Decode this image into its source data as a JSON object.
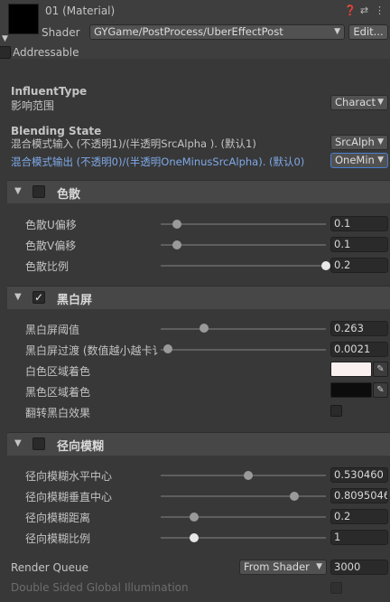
{
  "header": {
    "material_title": "01 (Material)",
    "shader_label": "Shader",
    "shader_value": "GYGame/PostProcess/UberEffectPost",
    "edit_label": "Edit...",
    "icons": [
      "help-icon",
      "preset-icon",
      "settings-icon"
    ],
    "addressable_label": "Addressable"
  },
  "influent": {
    "title": "InfluentType",
    "subtitle": "影响范围",
    "value": "Charact"
  },
  "blending": {
    "title": "Blending State",
    "src_label": "混合模式输入 (不透明1)/(半透明SrcAlpha ). (默认1)",
    "src_value": "SrcAlph",
    "dst_label": "混合模式输出 (不透明0)/(半透明OneMinusSrcAlpha). (默认0)",
    "dst_value": "OneMin"
  },
  "dispersion": {
    "title": "色散",
    "checked": false,
    "rows": [
      {
        "label": "色散U偏移",
        "value": "0.1",
        "pos": 0.1
      },
      {
        "label": "色散V偏移",
        "value": "0.1",
        "pos": 0.1
      },
      {
        "label": "色散比例",
        "value": "0.2",
        "pos": 1.0
      }
    ]
  },
  "bw": {
    "title": "黑白屏",
    "checked": true,
    "threshold_label": "黑白屏阈值",
    "threshold_value": "0.263",
    "threshold_pos": 0.263,
    "transition_label": "黑白屏过渡 (数值越小越卡讠",
    "transition_value": "0.0021",
    "transition_pos": 0.0021,
    "white_label": "白色区域着色",
    "white_color": "#fbf0f0",
    "black_label": "黑色区域着色",
    "black_color": "#0c0c0c",
    "invert_label": "翻转黑白效果"
  },
  "radial": {
    "title": "径向模糊",
    "checked": false,
    "rows": [
      {
        "label": "径向模糊水平中心",
        "value": "0.530460",
        "pos": 0.53046
      },
      {
        "label": "径向模糊垂直中心",
        "value": "0.8095046",
        "pos": 0.8095
      },
      {
        "label": "径向模糊距离",
        "value": "0.2",
        "pos": 0.2
      },
      {
        "label": "径向模糊比例",
        "value": "1",
        "pos": 0.2
      }
    ]
  },
  "footer": {
    "render_queue_label": "Render Queue",
    "render_queue_mode": "From Shader",
    "render_queue_value": "3000",
    "double_sided_label": "Double Sided Global Illumination"
  }
}
